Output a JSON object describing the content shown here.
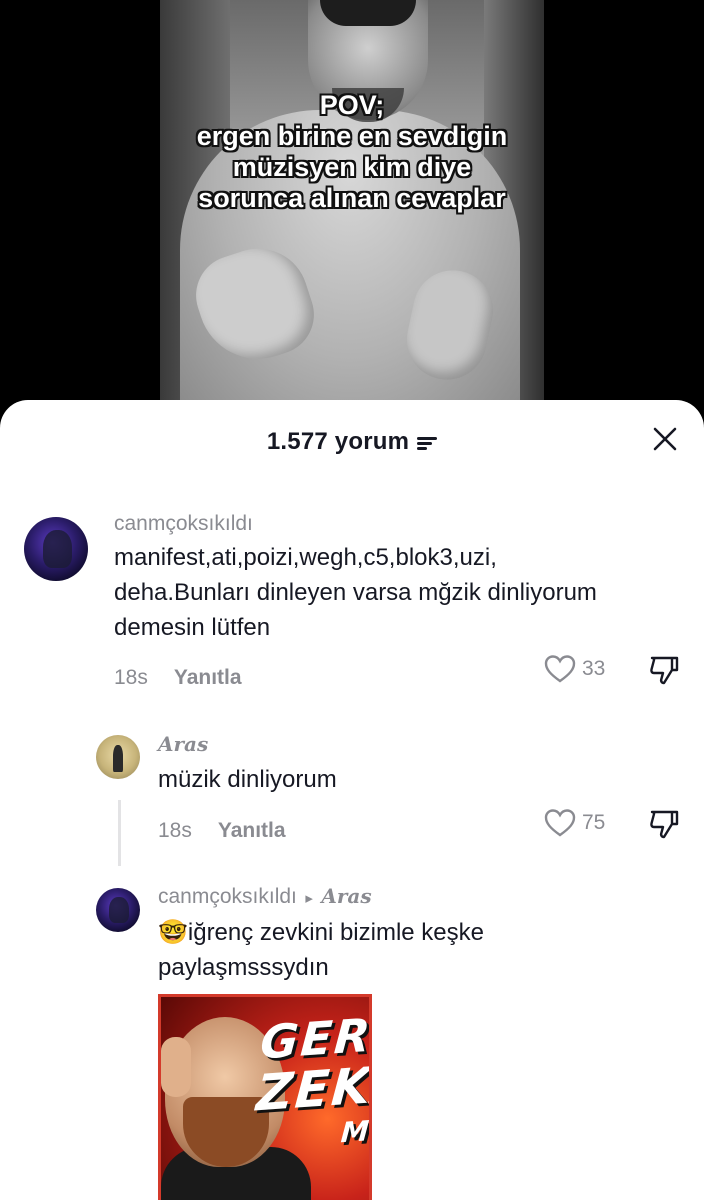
{
  "video": {
    "caption_lines": [
      "POV;",
      "ergen birine en sevdigin",
      "müzisyen kim diye",
      "sorunca alınan cevaplar"
    ]
  },
  "comments_sheet": {
    "count_label": "1.577 yorum",
    "close_icon": "close-icon",
    "sort_icon": "sort-icon"
  },
  "comments": [
    {
      "username": "canmçoksıkıldı",
      "text_lines": [
        "manifest,ati,poizi,wegh,c5,blok3,uzi,",
        "deha.Bunları dinleyen varsa mğzik dinliyorum",
        "demesin lütfen"
      ],
      "time": "18s",
      "reply_label": "Yanıtla",
      "likes": "33"
    },
    {
      "username": "Aras",
      "text": "müzik dinliyorum",
      "time": "18s",
      "reply_label": "Yanıtla",
      "likes": "75"
    },
    {
      "username": "canmçoksıkıldı",
      "reply_arrow": "▸",
      "reply_to": "Aras",
      "text_lines": [
        "🤓iğrenç zevkini bizimle keşke",
        "paylaşmsssydın"
      ],
      "thumbnail": {
        "line1": "GERİ",
        "line2": "ZEKA",
        "line3": "MI"
      }
    }
  ],
  "colors": {
    "sheet_bg": "#ffffff",
    "text_primary": "#161823",
    "text_secondary": "#8a8b91",
    "page_bg": "#000000"
  }
}
